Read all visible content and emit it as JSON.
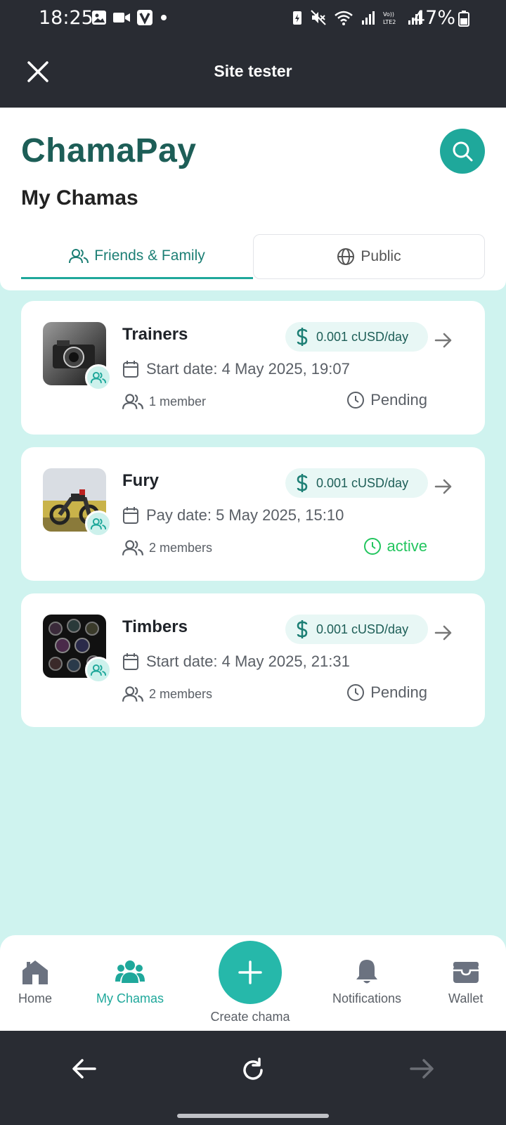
{
  "status_bar": {
    "time": "18:25",
    "battery": "47%"
  },
  "topbar": {
    "title": "Site tester"
  },
  "header": {
    "brand": "ChamaPay",
    "section_title": "My Chamas",
    "tabs": [
      {
        "label": "Friends & Family",
        "active": true
      },
      {
        "label": "Public",
        "active": false
      }
    ]
  },
  "chamas": [
    {
      "name": "Trainers",
      "price": "0.001 cUSD/day",
      "date": "Start date: 4 May 2025, 19:07",
      "members": "1 member",
      "status": "Pending",
      "status_color": "#5a5f66",
      "thumb_icon": "camera-photo-icon"
    },
    {
      "name": "Fury",
      "price": "0.001 cUSD/day",
      "date": "Pay date: 5 May 2025, 15:10",
      "members": "2 members",
      "status": "active",
      "status_color": "#22c55e",
      "thumb_icon": "motorcycle-photo-icon"
    },
    {
      "name": "Timbers",
      "price": "0.001 cUSD/day",
      "date": "Start date: 4 May 2025, 21:31",
      "members": "2 members",
      "status": "Pending",
      "status_color": "#5a5f66",
      "thumb_icon": "lenses-photo-icon"
    }
  ],
  "bottom_nav": {
    "home": "Home",
    "my_chamas": "My Chamas",
    "create": "Create chama",
    "notifications": "Notifications",
    "wallet": "Wallet"
  },
  "colors": {
    "accent": "#1fa89b",
    "brand": "#1d5e57",
    "background": "#cff3ef",
    "dark_bar": "#292c33"
  }
}
